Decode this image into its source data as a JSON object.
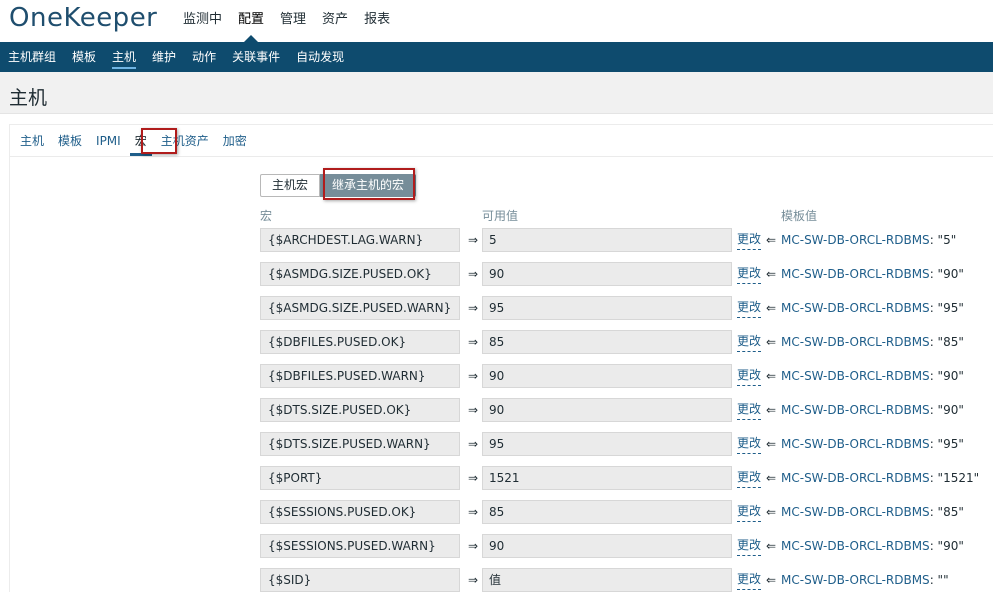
{
  "app": {
    "logo": "OneKeeper"
  },
  "top_menu": [
    {
      "label": "监测中",
      "active": false
    },
    {
      "label": "配置",
      "active": true
    },
    {
      "label": "管理",
      "active": false
    },
    {
      "label": "资产",
      "active": false
    },
    {
      "label": "报表",
      "active": false
    }
  ],
  "sub_nav": [
    {
      "label": "主机群组",
      "active": false
    },
    {
      "label": "模板",
      "active": false
    },
    {
      "label": "主机",
      "active": true
    },
    {
      "label": "维护",
      "active": false
    },
    {
      "label": "动作",
      "active": false
    },
    {
      "label": "关联事件",
      "active": false
    },
    {
      "label": "自动发现",
      "active": false
    }
  ],
  "page": {
    "title": "主机"
  },
  "tabs": [
    {
      "label": "主机",
      "active": false
    },
    {
      "label": "模板",
      "active": false
    },
    {
      "label": "IPMI",
      "active": false
    },
    {
      "label": "宏",
      "active": true
    },
    {
      "label": "主机资产",
      "active": false
    },
    {
      "label": "加密",
      "active": false
    }
  ],
  "toggle": {
    "host_macros_label": "主机宏",
    "inherited_label": "继承主机的宏"
  },
  "columns": {
    "macro": "宏",
    "effective_value": "可用值",
    "template_value": "模板值"
  },
  "symbols": {
    "arrow_right": "⇒",
    "arrow_left": "⇐",
    "change_label": "更改"
  },
  "macros": [
    {
      "macro": "{$ARCHDEST.LAG.WARN}",
      "value": "5",
      "template": "MC-SW-DB-ORCL-RDBMS",
      "template_value": ": \"5\""
    },
    {
      "macro": "{$ASMDG.SIZE.PUSED.OK}",
      "value": "90",
      "template": "MC-SW-DB-ORCL-RDBMS",
      "template_value": ": \"90\""
    },
    {
      "macro": "{$ASMDG.SIZE.PUSED.WARN}",
      "value": "95",
      "template": "MC-SW-DB-ORCL-RDBMS",
      "template_value": ": \"95\""
    },
    {
      "macro": "{$DBFILES.PUSED.OK}",
      "value": "85",
      "template": "MC-SW-DB-ORCL-RDBMS",
      "template_value": ": \"85\""
    },
    {
      "macro": "{$DBFILES.PUSED.WARN}",
      "value": "90",
      "template": "MC-SW-DB-ORCL-RDBMS",
      "template_value": ": \"90\""
    },
    {
      "macro": "{$DTS.SIZE.PUSED.OK}",
      "value": "90",
      "template": "MC-SW-DB-ORCL-RDBMS",
      "template_value": ": \"90\""
    },
    {
      "macro": "{$DTS.SIZE.PUSED.WARN}",
      "value": "95",
      "template": "MC-SW-DB-ORCL-RDBMS",
      "template_value": ": \"95\""
    },
    {
      "macro": "{$PORT}",
      "value": "1521",
      "template": "MC-SW-DB-ORCL-RDBMS",
      "template_value": ": \"1521\""
    },
    {
      "macro": "{$SESSIONS.PUSED.OK}",
      "value": "85",
      "template": "MC-SW-DB-ORCL-RDBMS",
      "template_value": ": \"85\""
    },
    {
      "macro": "{$SESSIONS.PUSED.WARN}",
      "value": "90",
      "template": "MC-SW-DB-ORCL-RDBMS",
      "template_value": ": \"90\""
    },
    {
      "macro": "{$SID}",
      "value": "值",
      "template": "MC-SW-DB-ORCL-RDBMS",
      "template_value": ": \"\""
    }
  ],
  "colors": {
    "nav_bg": "#0e4b6e",
    "link": "#1f5e8a",
    "highlight_border": "#b01c1c",
    "toggle_active_bg": "#768d99"
  }
}
